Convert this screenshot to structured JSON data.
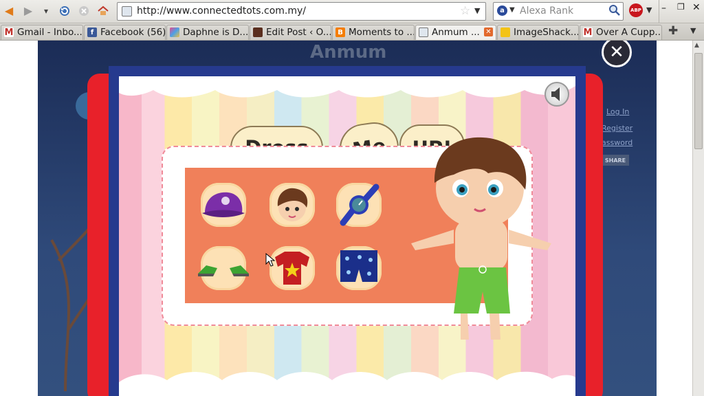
{
  "browser": {
    "url": "http://www.connectedtots.com.my/",
    "search_placeholder": "Alexa Rank",
    "adblock_label": "ABP",
    "tabs": [
      {
        "label": "Gmail - Inbo...",
        "icon": "gmail-icon"
      },
      {
        "label": "Facebook (56)",
        "icon": "facebook-icon"
      },
      {
        "label": "Daphne is D...",
        "icon": "site-icon"
      },
      {
        "label": "Edit Post ‹ O...",
        "icon": "site-icon"
      },
      {
        "label": "Moments to ...",
        "icon": "blogger-icon"
      },
      {
        "label": "Anmum ...",
        "icon": "page-icon",
        "active": true
      },
      {
        "label": "ImageShack...",
        "icon": "imageshack-icon"
      },
      {
        "label": "Over A Cupp...",
        "icon": "gmail-icon"
      }
    ]
  },
  "site": {
    "brand": "Anmum",
    "side_links": [
      "Log In",
      "Register",
      "assword"
    ],
    "share_label": "SHARE"
  },
  "game": {
    "title_words": [
      "Dress",
      "Me",
      "UP!"
    ],
    "items": [
      {
        "name": "cap",
        "color": "#7b2ea8"
      },
      {
        "name": "hair",
        "color": "#6b3a1e"
      },
      {
        "name": "watch",
        "color": "#2c3eb6"
      },
      {
        "name": "shoes",
        "color": "#3da332"
      },
      {
        "name": "t-shirt",
        "color": "#c41f22"
      },
      {
        "name": "shorts",
        "color": "#1b2f8a"
      }
    ],
    "colors": {
      "frame_red": "#e8212a",
      "frame_blue": "#263a8e",
      "panel_orange": "#f0805a",
      "shorts_green": "#6bc442"
    }
  }
}
